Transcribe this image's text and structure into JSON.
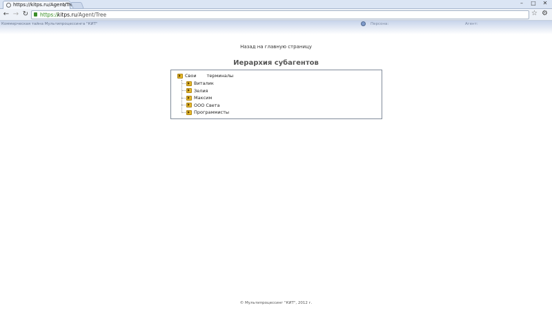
{
  "browser": {
    "tab_title": "https://kitps.ru/Agent/Tree",
    "tab_close": "×",
    "url_scheme": "https://",
    "url_host": "kitps.ru",
    "url_path": "/Agent/Tree",
    "back": "←",
    "forward": "→",
    "reload": "↻",
    "star": "☆",
    "menu": "⚙",
    "minimize": "–",
    "maximize": "□",
    "close": "✕"
  },
  "header": {
    "trade_secret": "Коммерческая тайна Мультипроцессинга \"КИТ\"",
    "person_label": "Персона:",
    "agent_label": "Агент:"
  },
  "content": {
    "back_link": "Назад на главную страницу",
    "title": "Иерархия субагентов",
    "tree": {
      "root": {
        "label": "Свои",
        "label2": "терминалы"
      },
      "children": [
        {
          "label": "Виталик"
        },
        {
          "label": "Зелия"
        },
        {
          "label": "Максим"
        },
        {
          "label": "ООО Света"
        },
        {
          "label": "Программисты"
        }
      ]
    }
  },
  "footer": {
    "copyright": "© Мультипроцессинг \"КИТ\", 2012 г."
  },
  "colors": {
    "header_gradient_top": "#c7d4ea",
    "folder": "#e6b92c",
    "url_secure": "#2e8a1c"
  }
}
